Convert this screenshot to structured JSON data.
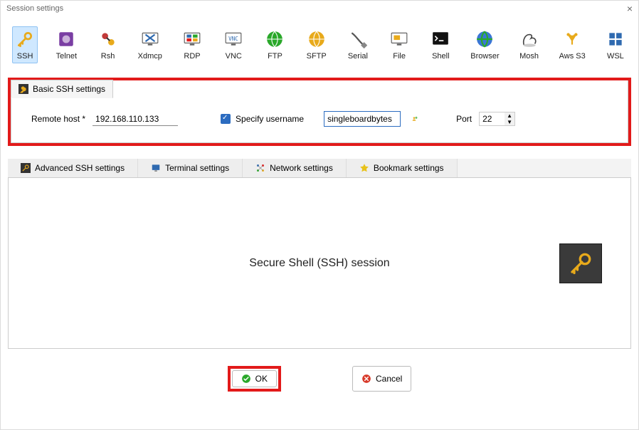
{
  "title": "Session settings",
  "sessionTypes": [
    {
      "label": "SSH",
      "icon": "key-icon",
      "color": "#e8aa1b",
      "selected": true
    },
    {
      "label": "Telnet",
      "icon": "telnet-icon",
      "color": "#7a3ea3"
    },
    {
      "label": "Rsh",
      "icon": "rsh-icon",
      "color": "#c23a3a"
    },
    {
      "label": "Xdmcp",
      "icon": "xdmcp-icon",
      "color": "#2f6ab0"
    },
    {
      "label": "RDP",
      "icon": "rdp-icon",
      "color": "#2f6ab0"
    },
    {
      "label": "VNC",
      "icon": "vnc-icon",
      "color": "#2f6ab0"
    },
    {
      "label": "FTP",
      "icon": "ftp-icon",
      "color": "#2aa82a"
    },
    {
      "label": "SFTP",
      "icon": "sftp-icon",
      "color": "#e8aa1b"
    },
    {
      "label": "Serial",
      "icon": "serial-icon",
      "color": "#555"
    },
    {
      "label": "File",
      "icon": "file-icon",
      "color": "#2f6ab0"
    },
    {
      "label": "Shell",
      "icon": "shell-icon",
      "color": "#111"
    },
    {
      "label": "Browser",
      "icon": "browser-icon",
      "color": "#2f8a2a"
    },
    {
      "label": "Mosh",
      "icon": "mosh-icon",
      "color": "#444"
    },
    {
      "label": "Aws S3",
      "icon": "aws-icon",
      "color": "#e8aa1b"
    },
    {
      "label": "WSL",
      "icon": "wsl-icon",
      "color": "#2f6ab0"
    }
  ],
  "basic": {
    "tab_label": "Basic SSH settings",
    "remote_host_label": "Remote host *",
    "remote_host_value": "192.168.110.133",
    "specify_username_label": "Specify username",
    "specify_username_checked": true,
    "username_value": "singleboardbytes",
    "port_label": "Port",
    "port_value": "22"
  },
  "subtabs": [
    {
      "label": "Advanced SSH settings",
      "iconcolor": "#e8aa1b"
    },
    {
      "label": "Terminal settings",
      "iconcolor": "#2f6ab0"
    },
    {
      "label": "Network settings",
      "iconcolor": "#2f6ab0"
    },
    {
      "label": "Bookmark settings",
      "iconcolor": "#e8c21b"
    }
  ],
  "session_preview_title": "Secure Shell (SSH) session",
  "footer": {
    "ok_label": "OK",
    "cancel_label": "Cancel"
  }
}
